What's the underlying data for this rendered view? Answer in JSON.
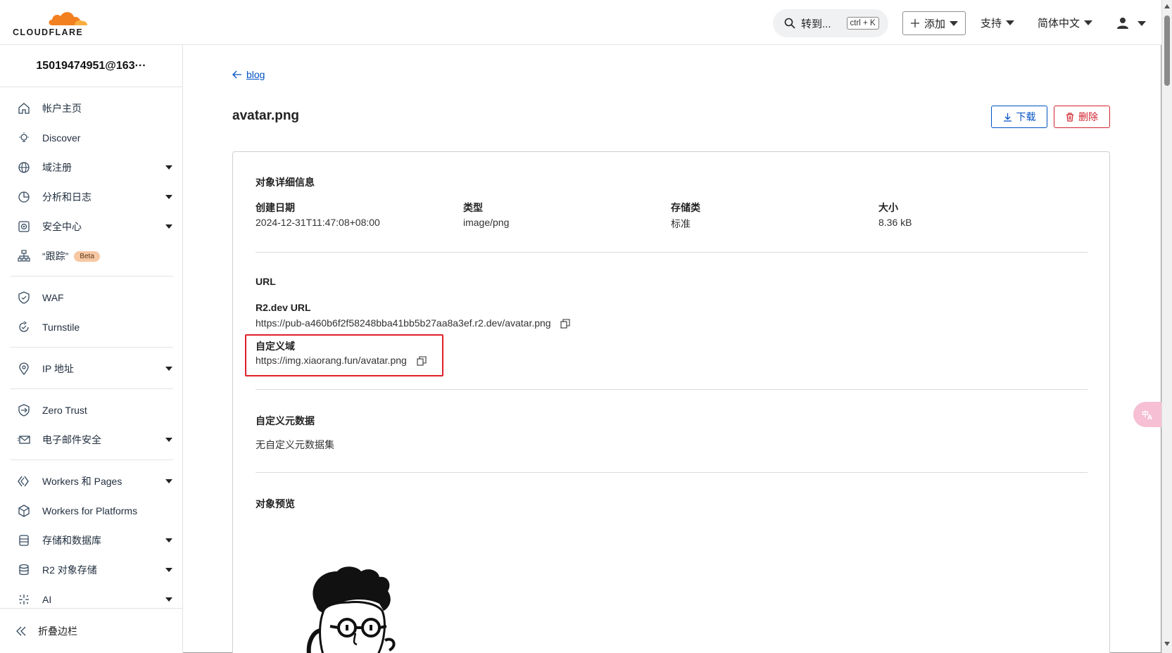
{
  "header": {
    "logo_text": "CLOUDFLARE",
    "search_label": "转到...",
    "search_shortcut": "ctrl + K",
    "add_label": "添加",
    "support_label": "支持",
    "language_label": "简体中文"
  },
  "sidebar": {
    "account": "15019474951@163···",
    "items": [
      {
        "label": "帐户主页"
      },
      {
        "label": "Discover"
      },
      {
        "label": "域注册"
      },
      {
        "label": "分析和日志"
      },
      {
        "label": "安全中心"
      },
      {
        "label": "“跟踪”",
        "badge": "Beta"
      },
      {
        "label": "WAF"
      },
      {
        "label": "Turnstile"
      },
      {
        "label": "IP 地址"
      },
      {
        "label": "Zero Trust"
      },
      {
        "label": "电子邮件安全"
      },
      {
        "label": "Workers 和 Pages"
      },
      {
        "label": "Workers for Platforms"
      },
      {
        "label": "存储和数据库"
      },
      {
        "label": "R2 对象存储"
      },
      {
        "label": "AI"
      }
    ],
    "collapse_label": "折叠边栏"
  },
  "main": {
    "back_label": "blog",
    "title": "avatar.png",
    "download_label": "下载",
    "delete_label": "删除",
    "details": {
      "title": "对象详细信息",
      "created_label": "创建日期",
      "created_value": "2024-12-31T11:47:08+08:00",
      "type_label": "类型",
      "type_value": "image/png",
      "storage_label": "存储类",
      "storage_value": "标准",
      "size_label": "大小",
      "size_value": "8.36 kB"
    },
    "url": {
      "title": "URL",
      "r2_label": "R2.dev URL",
      "r2_value": "https://pub-a460b6f2f58248bba41bb5b27aa8a3ef.r2.dev/avatar.png",
      "custom_label": "自定义域",
      "custom_value": "https://img.xiaorang.fun/avatar.png"
    },
    "metadata": {
      "title": "自定义元数据",
      "value": "无自定义元数据集"
    },
    "preview": {
      "title": "对象预览"
    }
  },
  "colors": {
    "accent": "#0051c3",
    "danger": "#d1242f",
    "brand_orange": "#f38020",
    "highlight_box": "#e0202a"
  }
}
